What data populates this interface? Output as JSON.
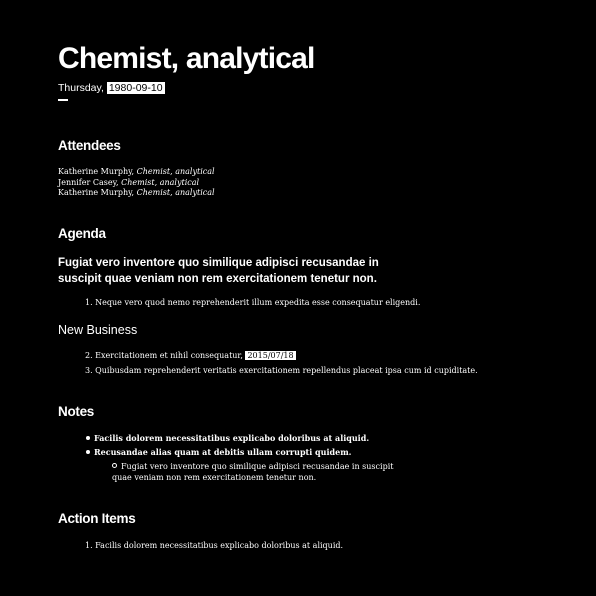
{
  "header": {
    "title": "Chemist, analytical",
    "weekday": "Thursday,",
    "date": "1980-09-10"
  },
  "attendees": {
    "heading": "Attendees",
    "people": [
      {
        "name": "Katherine Murphy,",
        "role": "Chemist, analytical"
      },
      {
        "name": "Jennifer Casey,",
        "role": "Chemist, analytical"
      },
      {
        "name": "Katherine Murphy,",
        "role": "Chemist, analytical"
      }
    ]
  },
  "agenda": {
    "heading": "Agenda",
    "lead": "Fugiat vero inventore quo similique adipisci recusandae in suscipit quae veniam non rem exercitationem tenetur non.",
    "items": [
      "1. Neque vero quod nemo reprehenderit illum expedita esse consequatur eligendi."
    ]
  },
  "new_business": {
    "heading": "New Business",
    "items": [
      {
        "text": "2. Exercitationem et nihil consequatur,",
        "date": "2015/07/18"
      },
      {
        "text": "3. Quibusdam reprehenderit veritatis exercitationem repellendus placeat ipsa cum id cupiditate.",
        "date": ""
      }
    ]
  },
  "notes": {
    "heading": "Notes",
    "items": [
      "Facilis dolorem necessitatibus explicabo doloribus at aliquid.",
      "Recusandae alias quam at debitis ullam corrupti quidem."
    ],
    "sub_item": "Fugiat vero inventore quo similique adipisci recusandae in suscipit quae veniam non rem exercitationem tenetur non."
  },
  "action_items": {
    "heading": "Action Items",
    "items": [
      "1. Facilis dolorem necessitatibus explicabo doloribus at aliquid."
    ]
  }
}
